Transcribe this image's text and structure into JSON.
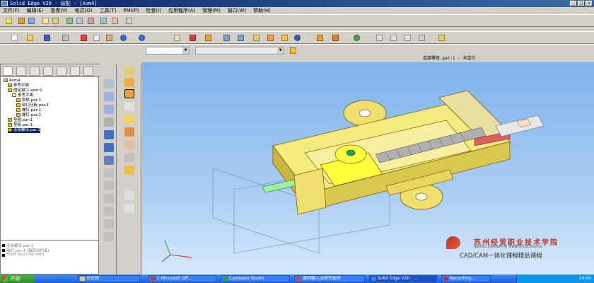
{
  "window": {
    "title": "Solid Edge V20 - 装配 - [Asm4]",
    "controls": [
      "_",
      "□",
      "×"
    ]
  },
  "menu": [
    "文件(F)",
    "编辑(E)",
    "查看(V)",
    "格式(O)",
    "工具(T)",
    "PMI(P)",
    "检查(I)",
    "应用程序(A)",
    "管理(M)",
    "窗口(W)",
    "帮助(H)"
  ],
  "status": {
    "breadcrumb": "连接螺母.par:1 - 未定位"
  },
  "tree": {
    "root": "Asm4",
    "items": [
      {
        "label": "参考平面",
        "indent": 1
      },
      {
        "label": "固定钳口 asm:1",
        "indent": 1
      },
      {
        "label": "参考平面",
        "indent": 2
      },
      {
        "label": "钳体.par:1",
        "indent": 2
      },
      {
        "label": "钳口压板.par:1",
        "indent": 2
      },
      {
        "label": "螺钉.par:1",
        "indent": 2
      },
      {
        "label": "螺钉.par:2",
        "indent": 2
      },
      {
        "label": "垫圈.par:1",
        "indent": 1
      },
      {
        "label": "垫板.par:1",
        "indent": 1
      },
      {
        "label": "连接螺母.par:1",
        "indent": 1,
        "selected": true
      }
    ],
    "lower": [
      "连接螺母.par:1",
      "轴杆.par:1  (轴转动约束)",
      "Front (xz)   (-00 mm)"
    ]
  },
  "watermark": {
    "school_cn": "苏州经贸职业技术学院",
    "school_en": "Suzhou Institute of Trade & Commerce",
    "subtitle": "CAD/CAM一体化课程精品课程"
  },
  "taskbar": {
    "start": "开始",
    "tasks": [
      {
        "label": "台式钳",
        "active": false
      },
      {
        "label": "2 Microsoft Off...",
        "active": false
      },
      {
        "label": "Camtasia Studio",
        "active": false
      },
      {
        "label": "搜狗输入法研究程序",
        "active": false
      },
      {
        "label": "Solid Edge V20 - ...",
        "active": true
      },
      {
        "label": "Recording...",
        "active": false
      }
    ],
    "clock": "14:45"
  }
}
